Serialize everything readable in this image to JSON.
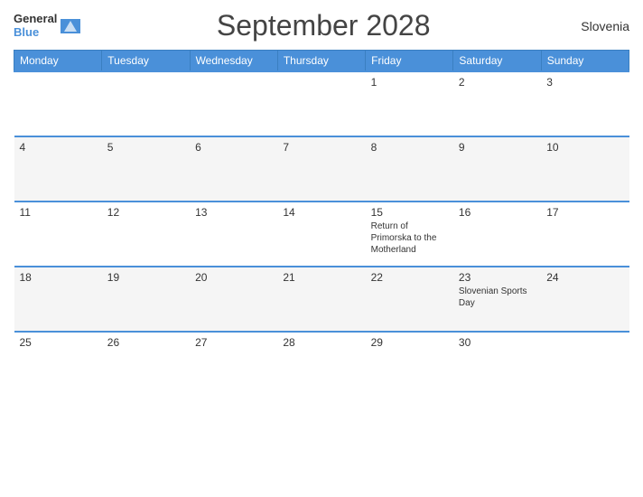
{
  "header": {
    "logo_general": "General",
    "logo_blue": "Blue",
    "title": "September 2028",
    "country": "Slovenia"
  },
  "days_of_week": [
    "Monday",
    "Tuesday",
    "Wednesday",
    "Thursday",
    "Friday",
    "Saturday",
    "Sunday"
  ],
  "weeks": [
    [
      {
        "num": "",
        "event": ""
      },
      {
        "num": "",
        "event": ""
      },
      {
        "num": "",
        "event": ""
      },
      {
        "num": "",
        "event": ""
      },
      {
        "num": "1",
        "event": ""
      },
      {
        "num": "2",
        "event": ""
      },
      {
        "num": "3",
        "event": ""
      }
    ],
    [
      {
        "num": "4",
        "event": ""
      },
      {
        "num": "5",
        "event": ""
      },
      {
        "num": "6",
        "event": ""
      },
      {
        "num": "7",
        "event": ""
      },
      {
        "num": "8",
        "event": ""
      },
      {
        "num": "9",
        "event": ""
      },
      {
        "num": "10",
        "event": ""
      }
    ],
    [
      {
        "num": "11",
        "event": ""
      },
      {
        "num": "12",
        "event": ""
      },
      {
        "num": "13",
        "event": ""
      },
      {
        "num": "14",
        "event": ""
      },
      {
        "num": "15",
        "event": "Return of Primorska to the Motherland"
      },
      {
        "num": "16",
        "event": ""
      },
      {
        "num": "17",
        "event": ""
      }
    ],
    [
      {
        "num": "18",
        "event": ""
      },
      {
        "num": "19",
        "event": ""
      },
      {
        "num": "20",
        "event": ""
      },
      {
        "num": "21",
        "event": ""
      },
      {
        "num": "22",
        "event": ""
      },
      {
        "num": "23",
        "event": "Slovenian Sports Day"
      },
      {
        "num": "24",
        "event": ""
      }
    ],
    [
      {
        "num": "25",
        "event": ""
      },
      {
        "num": "26",
        "event": ""
      },
      {
        "num": "27",
        "event": ""
      },
      {
        "num": "28",
        "event": ""
      },
      {
        "num": "29",
        "event": ""
      },
      {
        "num": "30",
        "event": ""
      },
      {
        "num": "",
        "event": ""
      }
    ]
  ]
}
